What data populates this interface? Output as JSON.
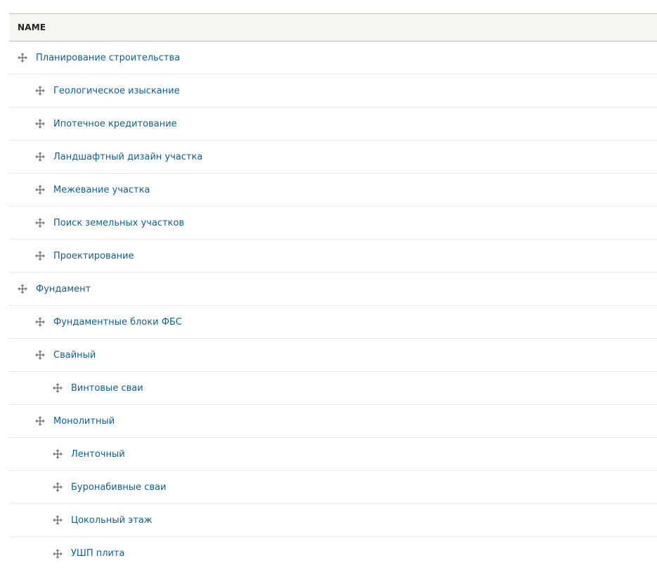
{
  "table": {
    "header_name": "NAME",
    "rows": [
      {
        "label": "Планирование строительства",
        "depth": 0
      },
      {
        "label": "Геологическое изыскание",
        "depth": 1
      },
      {
        "label": "Ипотечное кредитование",
        "depth": 1
      },
      {
        "label": "Ландшафтный дизайн участка",
        "depth": 1
      },
      {
        "label": "Межевание участка",
        "depth": 1
      },
      {
        "label": "Поиск земельных участков",
        "depth": 1
      },
      {
        "label": "Проектирование",
        "depth": 1
      },
      {
        "label": "Фундамент",
        "depth": 0
      },
      {
        "label": "Фундаментные блоки ФБС",
        "depth": 1
      },
      {
        "label": "Свайный",
        "depth": 1
      },
      {
        "label": "Винтовые сваи",
        "depth": 2
      },
      {
        "label": "Монолитный",
        "depth": 1
      },
      {
        "label": "Ленточный",
        "depth": 2
      },
      {
        "label": "Буронабивные сваи",
        "depth": 2
      },
      {
        "label": "Цокольный этаж",
        "depth": 2
      },
      {
        "label": "УШП плита",
        "depth": 2
      }
    ]
  },
  "icons": {
    "drag_handle": "move-arrows-icon"
  },
  "colors": {
    "link": "#0f5f91",
    "header_bg": "#f5f5f2",
    "icon": "#7a7a76"
  }
}
